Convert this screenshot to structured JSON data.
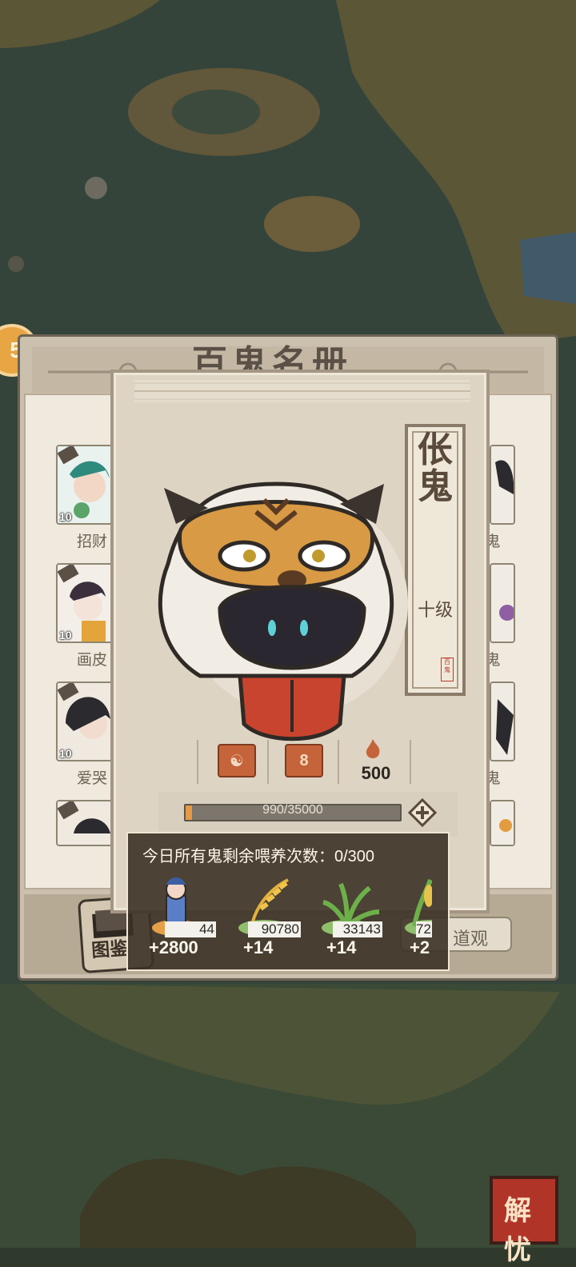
{
  "side_button_glyph": "5",
  "register": {
    "title": "百鬼名册",
    "left_cards": [
      {
        "name": "招财",
        "level": "10"
      },
      {
        "name": "画皮",
        "level": "10"
      },
      {
        "name": "爱哭",
        "level": "10"
      },
      {
        "name": "",
        "level": ""
      }
    ],
    "right_cards": [
      {
        "name": "鬼"
      },
      {
        "name": "鬼"
      },
      {
        "name": "鬼"
      },
      {
        "name": ""
      }
    ],
    "bottom": {
      "tujian_label": "图鉴",
      "daoguan_label": "道观"
    }
  },
  "ghost": {
    "name": "伥鬼",
    "level": "十级",
    "seal": "百鬼",
    "stats": {
      "box2_value": "8",
      "feed_value": "500"
    },
    "exp": {
      "current": 990,
      "max": 35000,
      "text": "990/35000"
    }
  },
  "feed_popup": {
    "title": "今日所有鬼剩余喂养次数：0/300",
    "items": [
      {
        "icon": "villager-icon",
        "qty": "44",
        "bonus": "+2800"
      },
      {
        "icon": "wheat-icon",
        "qty": "90780",
        "bonus": "+14"
      },
      {
        "icon": "grass-icon",
        "qty": "33143",
        "bonus": "+14"
      },
      {
        "icon": "corn-icon",
        "qty": "72",
        "bonus": "+2"
      }
    ]
  },
  "jieyou_label": "解忧",
  "colors": {
    "accent_orange": "#e69a45",
    "panel": "#ddd4c3",
    "popup_bg": "#3c3226"
  }
}
